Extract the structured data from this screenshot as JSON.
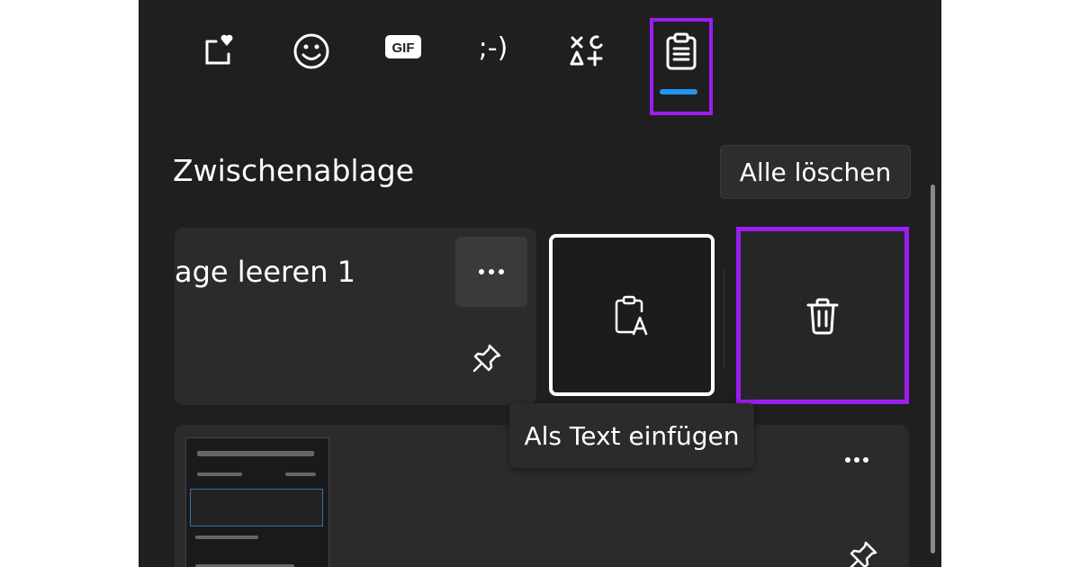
{
  "tabs": [
    {
      "name": "favorites-icon"
    },
    {
      "name": "emoji-icon"
    },
    {
      "name": "gif-icon",
      "label": "GIF"
    },
    {
      "name": "kaomoji-icon",
      "label": ";-)"
    },
    {
      "name": "symbols-icon"
    },
    {
      "name": "clipboard-icon",
      "selected": true
    }
  ],
  "clipboard": {
    "title": "Zwischenablage",
    "clear_all_label": "Alle löschen",
    "items": [
      {
        "text": "age leeren 1",
        "more_label": "···"
      },
      {
        "type": "image",
        "more_label": "···"
      }
    ]
  },
  "actions": {
    "paste_as_text_icon": "paste-text-icon",
    "delete_icon": "trash-icon"
  },
  "tooltip": {
    "text": "Als Text einfügen"
  },
  "colors": {
    "highlight": "#9b1df0",
    "accent": "#2196f3",
    "panel_bg": "#1f1f1f"
  }
}
